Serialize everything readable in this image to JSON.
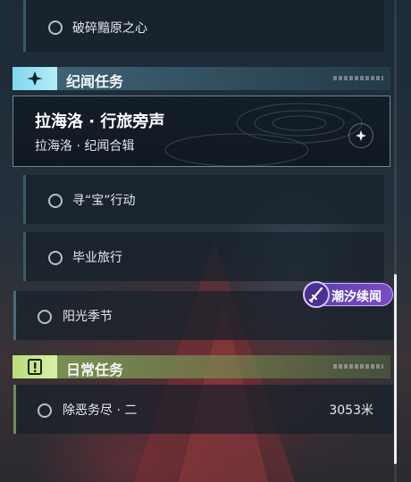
{
  "quests": {
    "top_item": {
      "label": "破碎黯原之心"
    },
    "story_section": {
      "title": "纪闻任务",
      "icon": "sparkle-star-icon",
      "accent": "#7fd6ef",
      "chain": {
        "name": "拉海洛 · 行旅旁声",
        "subtitle": "拉海洛 · 纪闻合辑",
        "icon": "star-emblem-icon"
      },
      "items": [
        {
          "label": "寻“宝”行动"
        },
        {
          "label": "毕业旅行"
        }
      ]
    },
    "side_item": {
      "label": "阳光季节"
    },
    "tide_tag": {
      "label": "潮汐续闻",
      "icon": "tide-sword-icon",
      "color": "#7a4bc8"
    },
    "daily_section": {
      "title": "日常任务",
      "icon": "exclamation-icon",
      "accent": "#b9dc7a",
      "items": [
        {
          "label": "除恶务尽 · 二",
          "distance": "3053米"
        }
      ]
    }
  }
}
